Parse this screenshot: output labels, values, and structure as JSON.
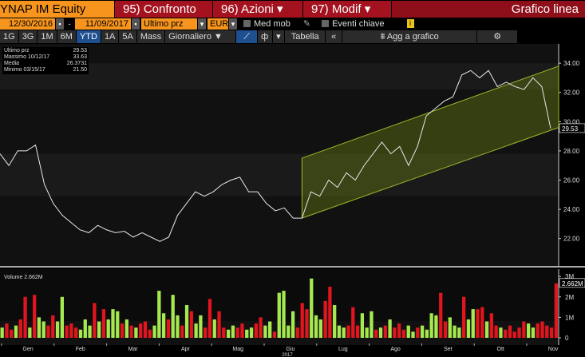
{
  "header": {
    "ticker": "YNAP IM Equity",
    "compare": "95) Confronto",
    "actions": "96) Azioni ▾",
    "modify": "97) Modif ▾",
    "chart_type": "Grafico linea"
  },
  "controls": {
    "start_date": "12/30/2016",
    "dash": "-",
    "end_date": "11/09/2017",
    "field": "Ultimo prz",
    "currency": "EUR",
    "moving_avg": "Med mob",
    "key_events": "Eventi chiave",
    "info": "i"
  },
  "toolbar": {
    "periods": [
      "1G",
      "3G",
      "1M",
      "6M",
      "YTD",
      "1A",
      "5A",
      "Mass"
    ],
    "active": "YTD",
    "frequency": "Giornaliero ▼",
    "table": "Tabella",
    "collapse": "«",
    "add_to_chart": "Agg a grafico",
    "settings": "⚙"
  },
  "legend": {
    "last_label": "Ultimo prz",
    "last": "29.53",
    "max_label": "Massimo 10/12/17",
    "max": "33.63",
    "avg_label": "Media",
    "avg": "26.3731",
    "min_label": "Minimo 03/15/17",
    "min": "21.50"
  },
  "volume_legend": "Volume 2.662M",
  "colors": {
    "up": "#a6e94f",
    "down": "#e0151d",
    "channel": "#9dbb2a",
    "accent": "#f7941d"
  },
  "chart_data": [
    {
      "type": "line",
      "title": "YNAP IM Equity",
      "ylim": [
        21,
        34.5
      ],
      "yticks": [
        22,
        24,
        26,
        28,
        30,
        32,
        34
      ],
      "last_value_label": "29.53",
      "series": [
        {
          "name": "Ultimo prz",
          "values": [
            27.8,
            27.0,
            28.0,
            28.0,
            28.4,
            25.7,
            24.4,
            23.6,
            23.1,
            22.6,
            22.4,
            22.9,
            22.6,
            22.4,
            22.5,
            22.1,
            22.4,
            22.1,
            21.8,
            22.1,
            23.6,
            24.4,
            25.2,
            24.9,
            25.2,
            25.7,
            26.0,
            26.2,
            25.2,
            25.2,
            24.4,
            23.9,
            24.1,
            23.4,
            23.4,
            25.2,
            24.9,
            26.0,
            25.5,
            26.5,
            26.0,
            27.0,
            27.8,
            28.6,
            27.8,
            28.3,
            27.0,
            28.3,
            30.4,
            30.9,
            31.4,
            31.7,
            33.2,
            33.5,
            33.0,
            33.5,
            32.4,
            32.7,
            32.4,
            32.2,
            33.0,
            32.4,
            29.53
          ]
        }
      ],
      "channel": {
        "start_index": 34,
        "lower": [
          23.4,
          29.6
        ],
        "upper": [
          27.5,
          33.8
        ]
      }
    },
    {
      "type": "bar",
      "title": "Volume",
      "ylabel": "",
      "ylim": [
        0,
        3.2
      ],
      "yticks": [
        "0",
        "1M",
        "2M",
        "3M"
      ],
      "last_value_label": "2.662M",
      "values": [
        0.5,
        0.7,
        0.4,
        0.6,
        0.9,
        2.0,
        0.5,
        2.1,
        1.0,
        0.8,
        0.6,
        1.1,
        0.8,
        2.0,
        0.6,
        0.7,
        0.5,
        0.4,
        0.9,
        0.6,
        1.7,
        0.8,
        1.4,
        0.9,
        1.4,
        1.3,
        0.7,
        0.9,
        0.6,
        0.5,
        0.7,
        0.8,
        0.4,
        0.6,
        2.3,
        1.2,
        0.9,
        2.1,
        1.1,
        0.6,
        1.6,
        1.3,
        0.7,
        1.1,
        0.5,
        1.9,
        0.9,
        1.3,
        0.5,
        0.4,
        0.6,
        0.5,
        0.7,
        0.4,
        0.5,
        0.7,
        1.0,
        0.6,
        0.8,
        0.3,
        2.2,
        2.3,
        0.6,
        1.3,
        0.5,
        1.7,
        1.4,
        2.9,
        1.1,
        0.9,
        1.8,
        2.5,
        1.6,
        0.6,
        0.5,
        0.6,
        1.5,
        0.6,
        1.2,
        0.5,
        1.3,
        0.4,
        0.5,
        0.6,
        0.9,
        0.5,
        0.7,
        0.4,
        0.6,
        0.3,
        0.5,
        0.6,
        0.4,
        1.2,
        1.1,
        2.2,
        0.8,
        1.0,
        0.6,
        0.5,
        2.0,
        0.9,
        1.4,
        1.4,
        1.5,
        0.8,
        1.2,
        0.6,
        0.5,
        0.4,
        0.6,
        0.3,
        0.5,
        0.8,
        0.7,
        0.5,
        0.7,
        0.8,
        0.6,
        0.5,
        2.66
      ],
      "directions": "uddudduduudduuddduuududuuudududdduuuduududuuddudduudduudduuduuuuddduuudduuuddduuudududdduuduuuudduuuduuddudduddddduudd"
    }
  ],
  "xaxis": {
    "months": [
      "Gen",
      "Feb",
      "Mar",
      "Apr",
      "Mag",
      "Giu",
      "Lug",
      "Ago",
      "Set",
      "Ott",
      "Nov"
    ],
    "year": "2017"
  }
}
